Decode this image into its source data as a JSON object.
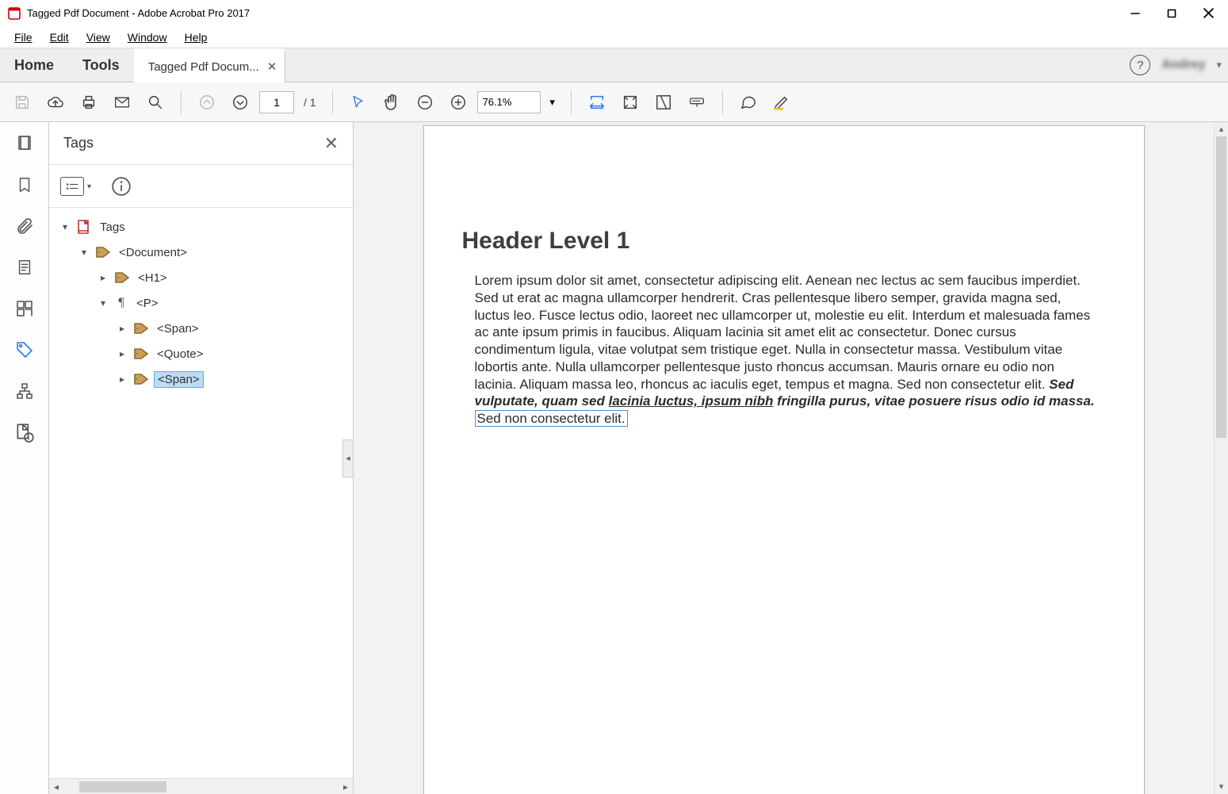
{
  "window": {
    "title": "Tagged Pdf Document - Adobe Acrobat Pro 2017"
  },
  "menu": {
    "file": "File",
    "edit": "Edit",
    "view": "View",
    "window": "Window",
    "help": "Help"
  },
  "tabs": {
    "home": "Home",
    "tools": "Tools",
    "doc": "Tagged Pdf Docum..."
  },
  "toolbar": {
    "page_current": "1",
    "page_total": "/  1",
    "zoom": "76.1%"
  },
  "user": {
    "name": "Andrey"
  },
  "panel": {
    "title": "Tags"
  },
  "tree": {
    "root": "Tags",
    "document": "<Document>",
    "h1": "<H1>",
    "p": "<P>",
    "span1": "<Span>",
    "quote": "<Quote>",
    "span2": "<Span>"
  },
  "doc": {
    "heading": "Header Level 1",
    "body_plain": "Lorem ipsum dolor sit amet, consectetur adipiscing elit. Aenean nec lectus ac sem faucibus imperdiet. Sed ut erat ac magna ullamcorper hendrerit. Cras pellentesque libero semper, gravida magna sed, luctus leo. Fusce lectus odio, laoreet nec ullamcorper ut, molestie eu elit. Interdum et malesuada fames ac ante ipsum primis in faucibus. Aliquam lacinia sit amet elit ac consectetur. Donec cursus condimentum ligula, vitae volutpat sem tristique eget. Nulla in consectetur massa. Vestibulum vitae lobortis ante. Nulla ullamcorper pellentesque justo rhoncus accumsan. Mauris ornare eu odio non lacinia. Aliquam massa leo, rhoncus ac iaculis eget, tempus et magna. Sed non consectetur elit. ",
    "body_bold_italic": "Sed vulputate, quam sed ",
    "body_bold_italic_link": "lacinia luctus, ipsum nibh",
    "body_bold_italic_tail": " fringilla purus, vitae posuere risus odio id massa.",
    "body_boxed": " Sed non consectetur elit. "
  }
}
